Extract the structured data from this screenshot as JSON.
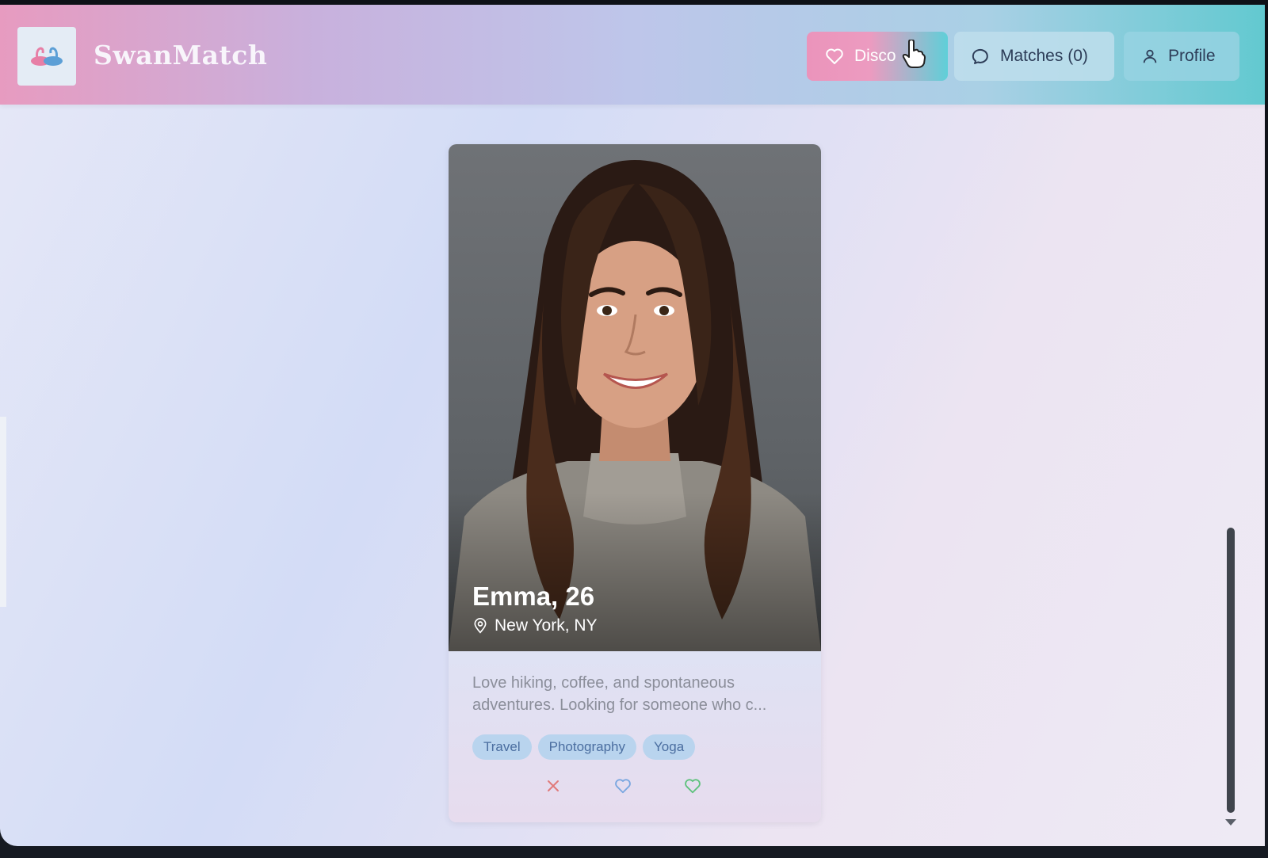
{
  "app": {
    "title": "SwanMatch",
    "logo_icon": "swan-logo-icon"
  },
  "nav": {
    "discover_label": "Disco",
    "matches_label": "Matches (0)",
    "profile_label": "Profile"
  },
  "profile_card": {
    "name_age": "Emma, 26",
    "location": "New York, NY",
    "bio": "Love hiking, coffee, and spontaneous adventures. Looking for someone who c...",
    "tags": [
      "Travel",
      "Photography",
      "Yoga"
    ]
  },
  "colors": {
    "brand_pink": "#eb94bb",
    "brand_teal": "#5fcfd8",
    "pass_red": "#e07a7a",
    "like_blue": "#7aa7e0",
    "superlike_green": "#5fc27d"
  }
}
